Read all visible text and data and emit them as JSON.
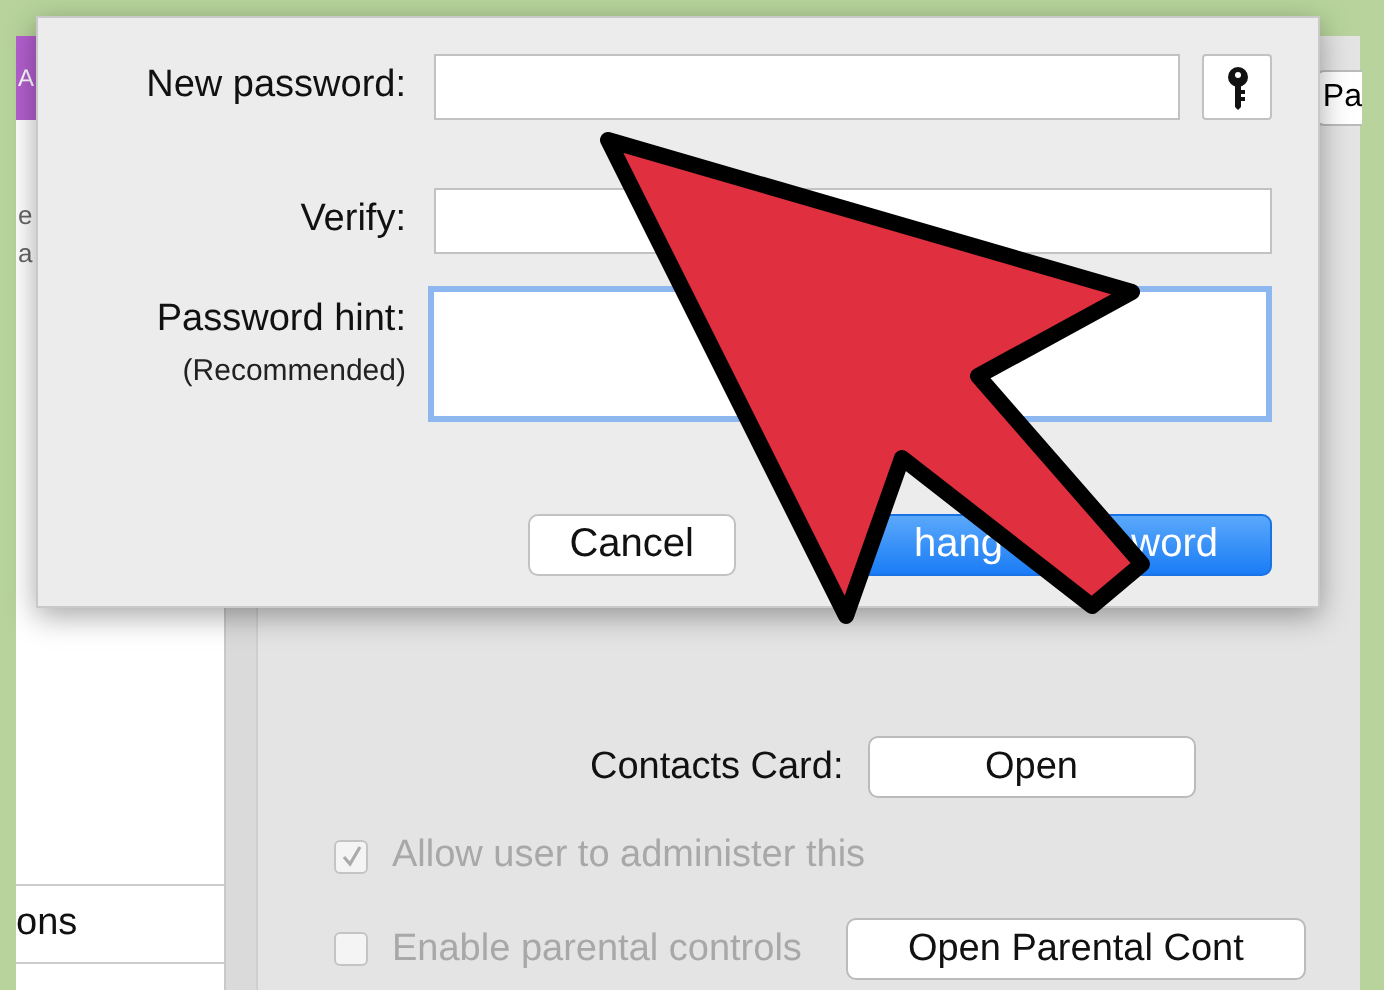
{
  "background": {
    "sidebar": {
      "badge": "A",
      "items": [
        "e",
        "a"
      ],
      "bottom_item": "ons"
    },
    "top_button": "Pa",
    "contacts_card": {
      "label": "Contacts Card:",
      "button": "Open"
    },
    "options": [
      {
        "label": "Allow user to administer this",
        "checked": true,
        "disabled": true
      },
      {
        "label": "Enable parental controls",
        "checked": false,
        "disabled": true,
        "button": "Open Parental Cont"
      }
    ]
  },
  "dialog": {
    "fields": [
      {
        "label": "New password:",
        "kind": "text",
        "focused": false,
        "key_button": true
      },
      {
        "label": "Verify:",
        "kind": "text",
        "focused": false,
        "key_button": false
      },
      {
        "label": "Password hint:",
        "sublabel": "(Recommended)",
        "kind": "textarea",
        "focused": true,
        "key_button": false
      }
    ],
    "buttons": [
      {
        "label": "Cancel",
        "default": false
      },
      {
        "label": "hang",
        "label_end": "word",
        "default": true
      }
    ]
  }
}
